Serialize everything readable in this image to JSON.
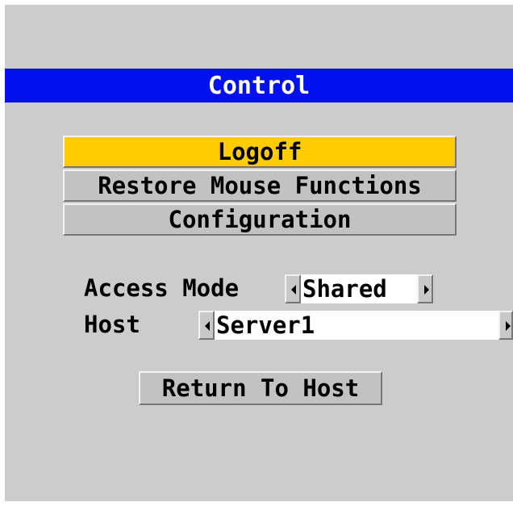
{
  "title": "Control",
  "menu": {
    "logoff": "Logoff",
    "restore_mouse": "Restore Mouse Functions",
    "configuration": "Configuration"
  },
  "access_mode": {
    "label": "Access Mode",
    "value": "Shared"
  },
  "host": {
    "label": "Host",
    "value": "Server1"
  },
  "return_button": "Return To Host",
  "colors": {
    "title_bar": "#0010ee",
    "selected": "#ffcc00",
    "background": "#cccccc"
  },
  "icons": {
    "prev": "triangle-left",
    "next": "triangle-right"
  }
}
